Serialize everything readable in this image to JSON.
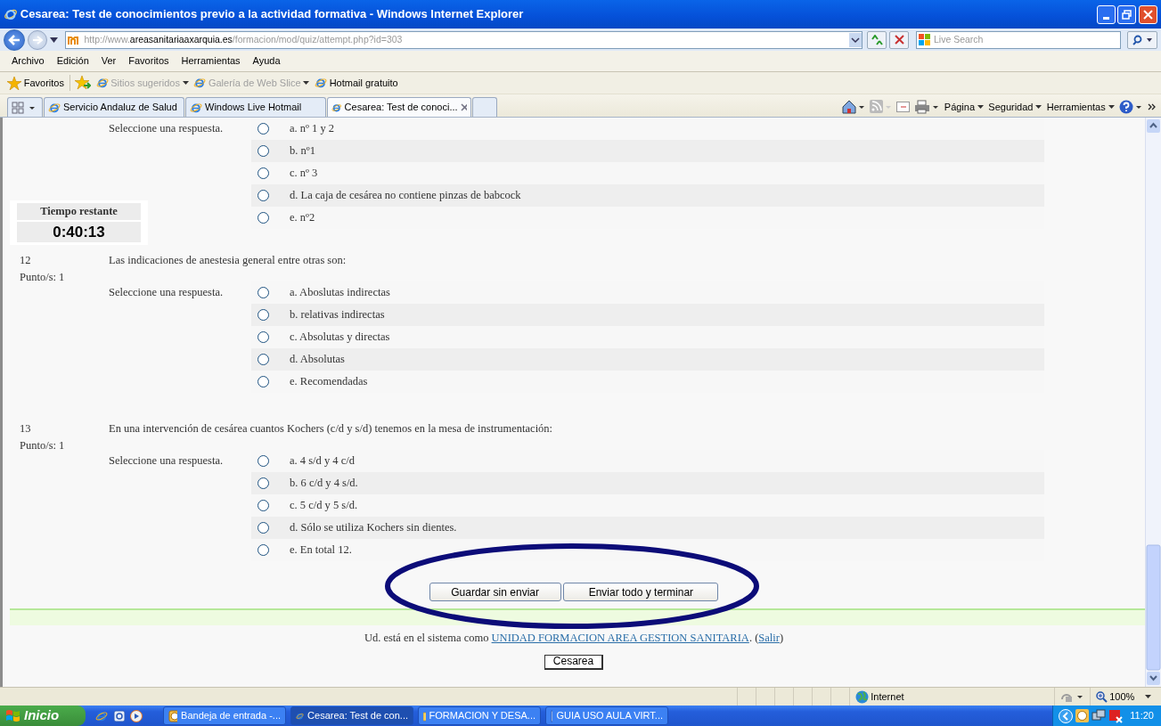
{
  "window": {
    "title": "Cesarea: Test de conocimientos previo a la actividad formativa - Windows Internet Explorer"
  },
  "address": {
    "prefix": "http://www.",
    "domain": "areasanitariaaxarquia.es",
    "path": "/formacion/mod/quiz/attempt.php?id=303"
  },
  "search": {
    "placeholder": "Live Search"
  },
  "menu": [
    "Archivo",
    "Edición",
    "Ver",
    "Favoritos",
    "Herramientas",
    "Ayuda"
  ],
  "favorites": {
    "label": "Favoritos",
    "items": [
      {
        "label": "Sitios sugeridos",
        "disabled": true,
        "dropdown": true
      },
      {
        "label": "Galería de Web Slice",
        "disabled": true,
        "dropdown": true
      },
      {
        "label": "Hotmail gratuito",
        "disabled": false,
        "dropdown": false
      }
    ]
  },
  "tabs": [
    {
      "label": "Servicio Andaluz de Salud",
      "selected": false
    },
    {
      "label": "Windows Live Hotmail",
      "selected": false
    },
    {
      "label": "Cesarea: Test de conoci...",
      "selected": true
    }
  ],
  "commands": [
    "Página",
    "Seguridad",
    "Herramientas"
  ],
  "timer": {
    "label": "Tiempo restante",
    "value": "0:40:13"
  },
  "questions": [
    {
      "prompt": "Seleccione una respuesta.",
      "options": [
        {
          "label": "a. nº 1 y 2",
          "selected": false
        },
        {
          "label": "b. nº1",
          "selected": false
        },
        {
          "label": "c. nº 3",
          "selected": false
        },
        {
          "label": "d. La caja de cesárea no contiene pinzas de babcock",
          "selected": false
        },
        {
          "label": "e. nº2",
          "selected": false
        }
      ]
    },
    {
      "number": "12",
      "points": "Punto/s: 1",
      "text": "Las indicaciones de anestesia general entre otras son:",
      "prompt": "Seleccione una respuesta.",
      "options": [
        {
          "label": "a. Aboslutas indirectas",
          "selected": false
        },
        {
          "label": "b. relativas indirectas",
          "selected": false
        },
        {
          "label": "c. Absolutas y directas",
          "selected": false
        },
        {
          "label": "d. Absolutas",
          "selected": false
        },
        {
          "label": "e. Recomendadas",
          "selected": false
        }
      ]
    },
    {
      "number": "13",
      "points": "Punto/s: 1",
      "text": "En una intervención de cesárea cuantos Kochers (c/d y s/d) tenemos en la mesa de instrumentación:",
      "prompt": "Seleccione una respuesta.",
      "options": [
        {
          "label": "a. 4 s/d y 4 c/d",
          "selected": false
        },
        {
          "label": "b. 6 c/d y 4 s/d.",
          "selected": false
        },
        {
          "label": "c. 5 c/d y 5 s/d.",
          "selected": false
        },
        {
          "label": "d. Sólo se utiliza Kochers sin dientes.",
          "selected": false
        },
        {
          "label": "e. En total 12.",
          "selected": false
        }
      ]
    }
  ],
  "buttons": [
    "Guardar sin enviar",
    "Enviar todo y terminar"
  ],
  "footer": {
    "prefix": "Ud. está en el sistema como ",
    "user": "UNIDAD FORMACION AREA GESTION SANITARIA",
    "middle": ". (",
    "logout": "Salir",
    "suffix": ")"
  },
  "course_button": "Cesarea",
  "status_bar": {
    "zone": "Internet",
    "zoom": "100%"
  },
  "taskbar": {
    "start": "Inicio",
    "tasks": [
      {
        "label": "Bandeja de entrada -...",
        "selected": false
      },
      {
        "label": "Cesarea: Test de con...",
        "selected": true
      },
      {
        "label": "FORMACION Y DESA...",
        "selected": false
      },
      {
        "label": "GUIA USO AULA VIRT...",
        "selected": false
      }
    ],
    "clock": "11:20"
  }
}
